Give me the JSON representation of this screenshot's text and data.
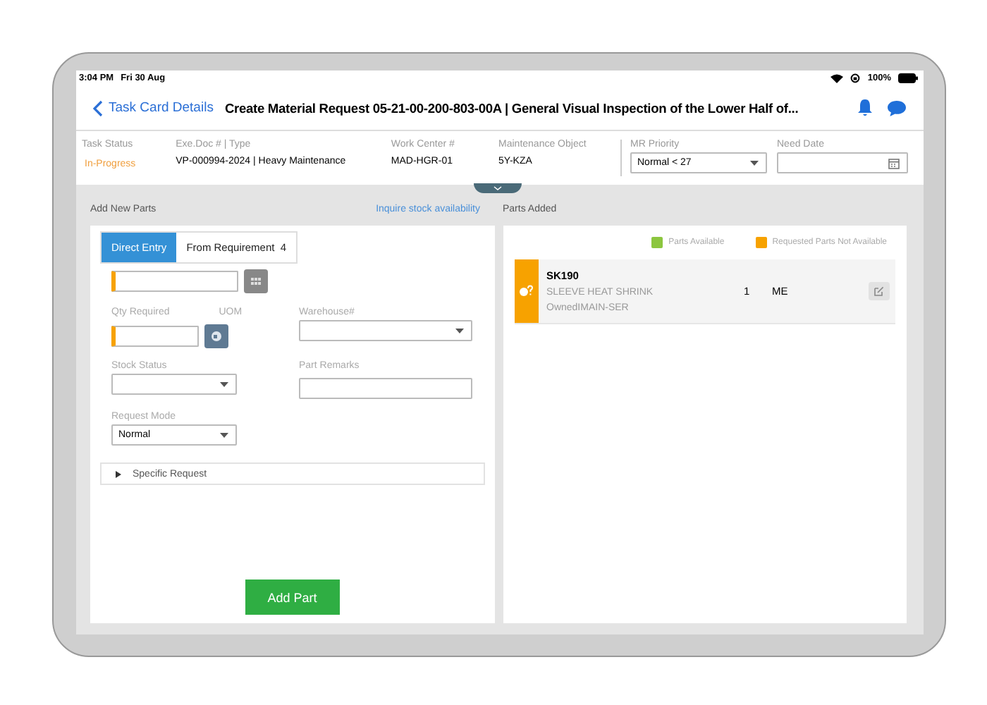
{
  "status_bar": {
    "time": "3:04 PM",
    "date": "Fri 30 Aug",
    "battery": "100%"
  },
  "nav": {
    "back": "Task Card Details",
    "title": "Create Material Request 05-21-00-200-803-00A | General Visual Inspection of the Lower Half of..."
  },
  "info": [
    {
      "label": "Task Status",
      "value": "In-Progress",
      "kind": "status"
    },
    {
      "label": "Exe.Doc # | Type",
      "value": "VP-000994-2024 | Heavy Maintenance",
      "kind": "text"
    },
    {
      "label": "Work Center #",
      "value": "MAD-HGR-01",
      "kind": "text"
    },
    {
      "label": "Maintenance Object",
      "value": "5Y-KZA",
      "kind": "text"
    }
  ],
  "mr_priority": {
    "label": "MR Priority",
    "value": "Normal < 27"
  },
  "need_date": {
    "label": "Need Date"
  },
  "add_parts": {
    "title": "Add New Parts",
    "link": "Inquire stock availability",
    "tabs": [
      {
        "label": "Direct Entry",
        "selected": true
      },
      {
        "label": "From Requirement",
        "count": "4",
        "selected": false
      }
    ],
    "qty_label": "Qty Required",
    "uom_label": "UOM",
    "warehouse_label": "Warehouse#",
    "stock_status_label": "Stock Status",
    "remarks_label": "Part Remarks",
    "mode_label": "Request Mode",
    "mode_value": "Normal",
    "specific": {
      "label": "Specific Request",
      "expanded": false
    },
    "button": "Add Part"
  },
  "parts_added": {
    "title": "Parts Added",
    "legend": [
      {
        "label": "Parts Available",
        "color": "#8cc63f"
      },
      {
        "label": "Requested Parts Not Available",
        "color": "#f7a200"
      }
    ],
    "parts": [
      {
        "code": "SK190",
        "description": "SLEEVE HEAT SHRINK",
        "owner": "OwnedIMAIN-SER",
        "qty": "1",
        "uom": "ME",
        "color": "#f7a200"
      }
    ]
  }
}
